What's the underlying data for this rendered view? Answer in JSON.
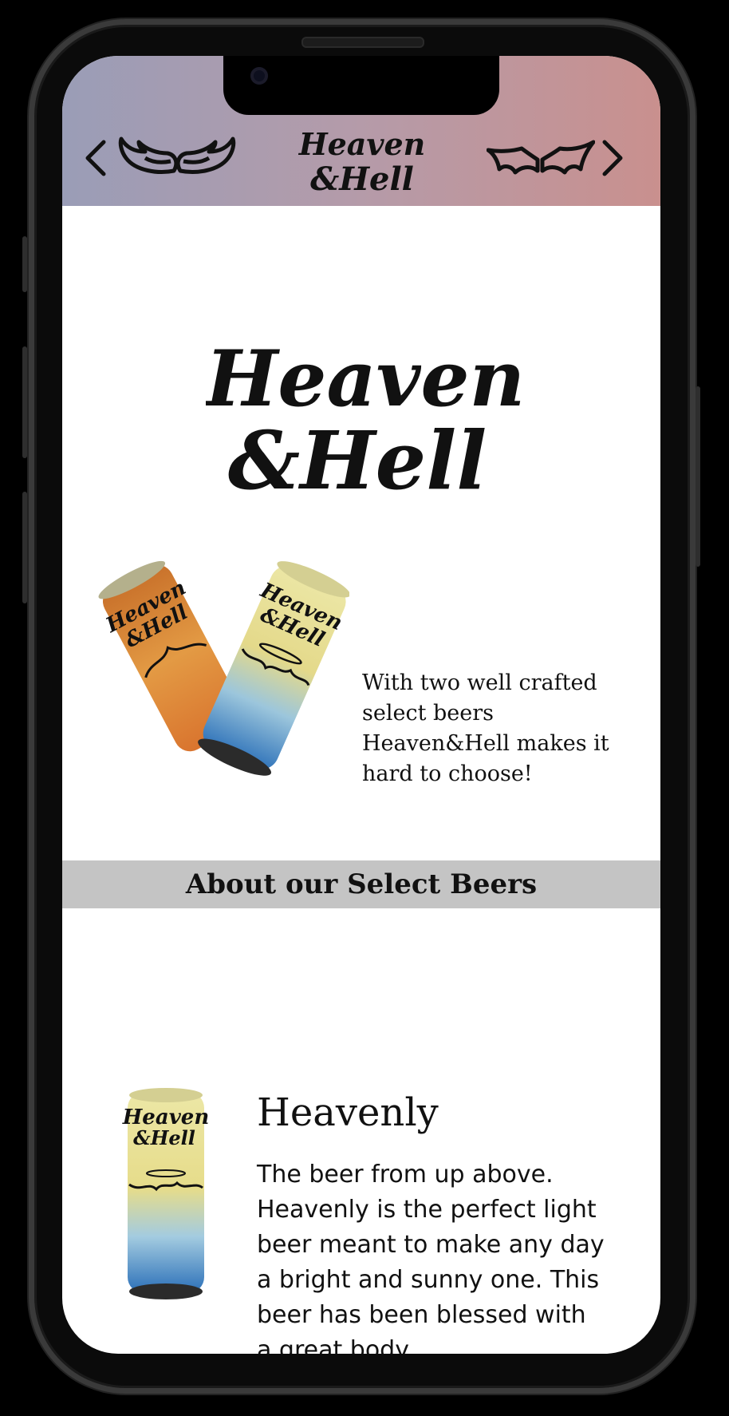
{
  "header": {
    "prev_icon": "chevron-left-icon",
    "next_icon": "chevron-right-icon",
    "left_emblem": "angel-wings-icon",
    "right_emblem": "bat-wings-icon",
    "logo_line1": "Heaven",
    "logo_line2": "&Hell"
  },
  "hero": {
    "logo_line1": "Heaven",
    "logo_line2": "&Hell"
  },
  "intro": {
    "text": "With two well crafted select beers Heaven&Hell makes it hard to choose!",
    "can_labels": [
      "Heaven",
      "&Hell"
    ]
  },
  "section": {
    "title": "About our Select Beers"
  },
  "product": {
    "name": "Heavenly",
    "description": "The beer from up above. Heavenly is the perfect light beer meant to make any day a bright and sunny one. This beer has been blessed with a great body",
    "can_label_line1": "Heaven",
    "can_label_line2": "&Hell"
  },
  "colors": {
    "header_left": "#9a9db7",
    "header_right": "#c9908e",
    "banner": "#c4c4c4",
    "heaven_can_top": "#e8e4a0",
    "heaven_can_bottom": "#2e86c8",
    "hell_can": "#e08a3a"
  }
}
